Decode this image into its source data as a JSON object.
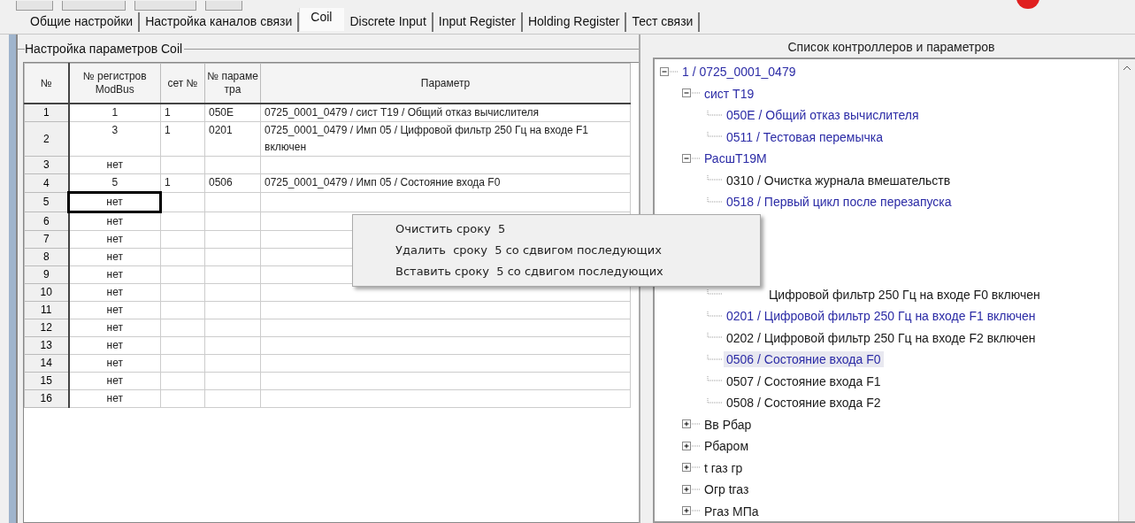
{
  "tabs": [
    {
      "label": "Общие настройки",
      "selected": false
    },
    {
      "label": "Настройка каналов связи",
      "selected": false
    },
    {
      "label": "Coil",
      "selected": true
    },
    {
      "label": "Discrete Input",
      "selected": false
    },
    {
      "label": "Input Register",
      "selected": false
    },
    {
      "label": "Holding Register",
      "selected": false
    },
    {
      "label": "Тест связи",
      "selected": false
    }
  ],
  "coil_panel": {
    "title": "Настройка параметров Coil",
    "table": {
      "columns": [
        "№",
        "№ регистров ModBus",
        "сет №",
        "№ параме тра",
        "Параметр"
      ],
      "rows": [
        {
          "num": "1",
          "modbus": "1",
          "net": "1",
          "param_no": "050E",
          "param": "0725_0001_0479 / сист Т19 / Общий отказ вычислителя",
          "focused": false
        },
        {
          "num": "2",
          "modbus": "3",
          "net": "1",
          "param_no": "0201",
          "param": "0725_0001_0479 / Имп 05 / Цифровой фильтр 250 Гц на входе F1 включен",
          "focused": false
        },
        {
          "num": "3",
          "modbus": "нет",
          "focused": false
        },
        {
          "num": "4",
          "modbus": "5",
          "net": "1",
          "param_no": "0506",
          "param": "0725_0001_0479 / Имп 05 / Состояние входа F0",
          "focused": false
        },
        {
          "num": "5",
          "modbus": "нет",
          "focused": true
        },
        {
          "num": "6",
          "modbus": "нет",
          "focused": false
        },
        {
          "num": "7",
          "modbus": "нет",
          "focused": false
        },
        {
          "num": "8",
          "modbus": "нет",
          "focused": false
        },
        {
          "num": "9",
          "modbus": "нет",
          "focused": false
        },
        {
          "num": "10",
          "modbus": "нет",
          "focused": false
        },
        {
          "num": "11",
          "modbus": "нет",
          "focused": false
        },
        {
          "num": "12",
          "modbus": "нет",
          "focused": false
        },
        {
          "num": "13",
          "modbus": "нет",
          "focused": false
        },
        {
          "num": "14",
          "modbus": "нет",
          "focused": false
        },
        {
          "num": "15",
          "modbus": "нет",
          "focused": false
        },
        {
          "num": "16",
          "modbus": "нет",
          "focused": false
        }
      ]
    }
  },
  "context_menu": [
    "Очистить сроку  5",
    "Удалить  сроку  5 со сдвигом последующих",
    "Вставить сроку  5 со сдвигом последующих"
  ],
  "tree_panel": {
    "title": "Список контроллеров и параметров",
    "tree": [
      {
        "label": "1 / 0725_0001_0479",
        "assigned": true,
        "selected": false,
        "expanded": true,
        "children": [
          {
            "label": "сист Т19",
            "assigned": true,
            "selected": false,
            "expanded": true,
            "children": [
              {
                "label": "050E / Общий отказ вычислителя",
                "assigned": true,
                "selected": false
              },
              {
                "label": "0511 / Тестовая перемычка",
                "assigned": true,
                "selected": false
              }
            ]
          },
          {
            "label": "РасшТ19М",
            "assigned": true,
            "selected": false,
            "expanded": true,
            "children": [
              {
                "label": "0310 / Очистка журнала вмешательств",
                "assigned": false,
                "selected": false
              },
              {
                "label": "0518 / Первый цикл после перезапуска",
                "assigned": true,
                "selected": false
              }
            ]
          },
          {
            "children": [
              {
                "kind": "cut",
                "label": "Цифровой фильтр 250 Гц на входе F0 включен",
                "assigned": false,
                "selected": false
              },
              {
                "label": "0201 / Цифровой фильтр 250 Гц на входе F1 включен",
                "assigned": true,
                "selected": false
              },
              {
                "label": "0202 / Цифровой фильтр 250 Гц на входе F2 включен",
                "assigned": false,
                "selected": false
              },
              {
                "label": "0506 / Состояние входа F0",
                "assigned": true,
                "selected": true
              },
              {
                "label": "0507 / Состояние входа F1",
                "assigned": false,
                "selected": false
              },
              {
                "label": "0508 / Состояние входа F2",
                "assigned": false,
                "selected": false
              }
            ]
          },
          {
            "label": "Вв Рбар",
            "assigned": false,
            "selected": false,
            "expanded": false
          },
          {
            "label": "Рбаром",
            "assigned": false,
            "selected": false,
            "expanded": false
          },
          {
            "label": "t газ гр",
            "assigned": false,
            "selected": false,
            "expanded": false
          },
          {
            "label": "Огр tгаз",
            "assigned": false,
            "selected": false,
            "expanded": false
          },
          {
            "label": "Pгаз МПа",
            "assigned": false,
            "selected": false,
            "expanded": false
          }
        ]
      }
    ]
  }
}
